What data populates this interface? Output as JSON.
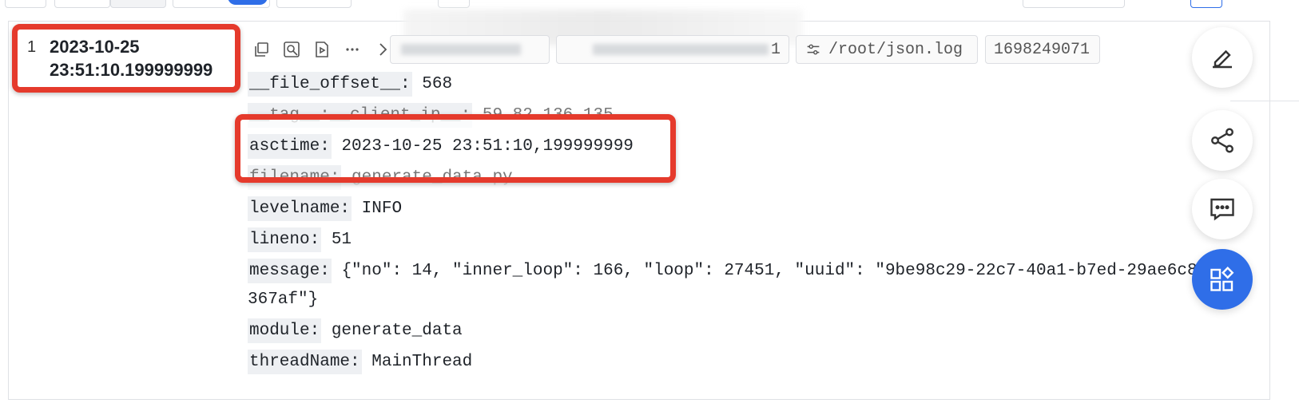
{
  "row": {
    "index": "1",
    "time_line1": "2023-10-25",
    "time_line2": "23:51:10.199999999"
  },
  "tags": {
    "source_value": "1",
    "path": "/root/json.log",
    "timestamp": "1698249071"
  },
  "fields": [
    {
      "key": "__file_offset__:",
      "value": "568"
    },
    {
      "key": "__tag__:__client_ip__:",
      "value": "59.82.136.135"
    },
    {
      "key": "asctime:",
      "value": "2023-10-25 23:51:10,199999999"
    },
    {
      "key": "filename:",
      "value": "generate_data.py"
    },
    {
      "key": "levelname:",
      "value": "INFO"
    },
    {
      "key": "lineno:",
      "value": "51"
    },
    {
      "key": "message:",
      "value": "{\"no\": 14, \"inner_loop\": 166, \"loop\": 27451, \"uuid\": \"9be98c29-22c7-40a1-b7ed-29ae6c8367af\"}"
    },
    {
      "key": "module:",
      "value": "generate_data"
    },
    {
      "key": "threadName:",
      "value": "MainThread"
    }
  ],
  "icons": {
    "row_tools": [
      "copy-icon",
      "search-context-icon",
      "play-icon",
      "more-icon",
      "chevron-right-icon"
    ],
    "fabs": [
      "edit-icon",
      "share-icon",
      "comment-icon",
      "apps-icon"
    ]
  },
  "colors": {
    "highlight": "#e53a2c",
    "primary": "#2f6ee8"
  }
}
